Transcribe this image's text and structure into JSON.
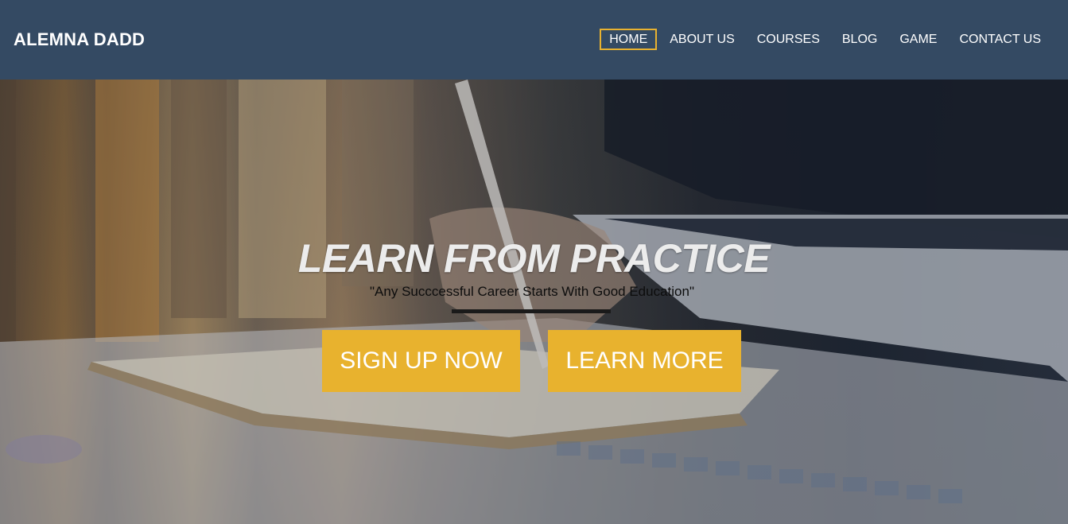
{
  "header": {
    "brand": "ALEMNA DADD",
    "nav": [
      {
        "label": "HOME",
        "active": true
      },
      {
        "label": "ABOUT US",
        "active": false
      },
      {
        "label": "COURSES",
        "active": false
      },
      {
        "label": "BLOG",
        "active": false
      },
      {
        "label": "GAME",
        "active": false
      },
      {
        "label": "CONTACT US",
        "active": false
      }
    ]
  },
  "hero": {
    "title": "LEARN FROM PRACTICE",
    "subtitle": "\"Any Succcessful Career Starts With Good Education\"",
    "buttons": {
      "signup": "SIGN UP NOW",
      "learn_more": "LEARN MORE"
    },
    "image_icon": "hand-writing-with-pen-photo"
  },
  "colors": {
    "header_bg": "#344a63",
    "accent": "#e8b22e",
    "nav_text": "#ffffff"
  }
}
